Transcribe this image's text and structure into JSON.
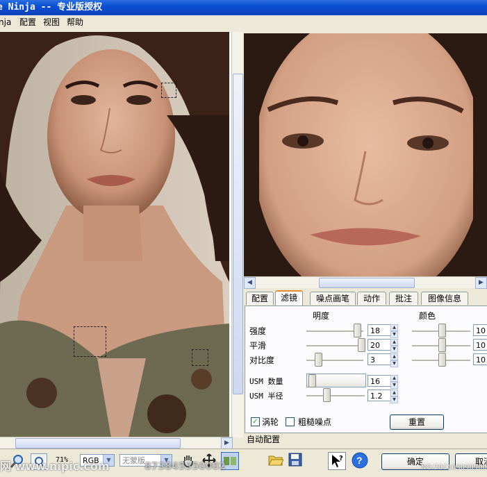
{
  "window": {
    "title": "e Ninja -- 专业版授权"
  },
  "menu": {
    "items": [
      "nja",
      "配置",
      "视图",
      "帮助"
    ]
  },
  "tabs": [
    "配置",
    "滤镜",
    "噪点画笔",
    "动作",
    "批注",
    "图像信息"
  ],
  "active_tab": 1,
  "panel": {
    "brightness_header": "明度",
    "color_header": "颜色",
    "sliders": [
      {
        "label": "强度",
        "value": "18",
        "color_value": "10"
      },
      {
        "label": "平滑",
        "value": "20",
        "color_value": "10"
      },
      {
        "label": "对比度",
        "value": "3",
        "color_value": "10"
      }
    ],
    "usm_amount_label": "USM 数量",
    "usm_amount_value": "16",
    "usm_radius_label": "USM 半径",
    "usm_radius_value": "1.2",
    "turbo_label": "涡轮",
    "turbo_checked": true,
    "coarse_noise_label": "粗糙噪点",
    "coarse_noise_checked": false,
    "reset_button": "重置"
  },
  "auto_config_label": "自动配置",
  "statusbar": {
    "zoom": "71%",
    "color_mode": "RGB",
    "mask_select": "无蒙版",
    "ok_button": "确定",
    "cancel_button": "取消"
  },
  "watermark": {
    "left": "网 www.nipic.com",
    "numbers": "873845350002",
    "right": "NO:20110309090053"
  },
  "colors": {
    "accent": "#0a4fd1",
    "tab_highlight": "#e68b2c"
  }
}
